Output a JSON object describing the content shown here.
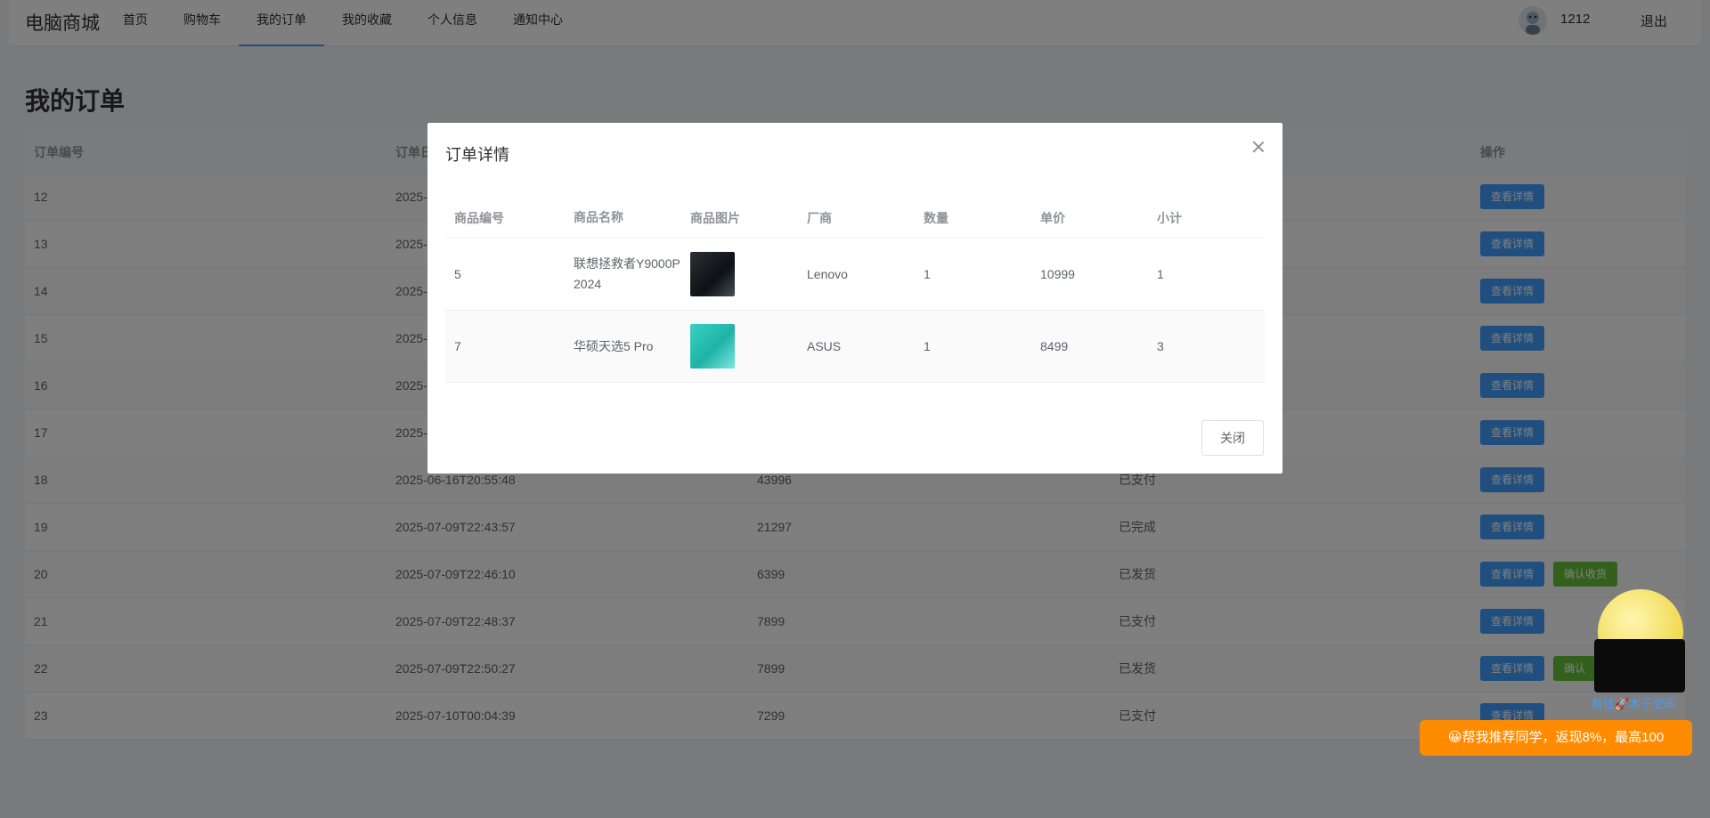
{
  "header": {
    "brand": "电脑商城",
    "nav": [
      "首页",
      "购物车",
      "我的订单",
      "我的收藏",
      "个人信息",
      "通知中心"
    ],
    "active_nav": "我的订单",
    "username": "1212",
    "logout": "退出"
  },
  "page": {
    "title": "我的订单"
  },
  "orders": {
    "columns": [
      "订单编号",
      "订单日期",
      "",
      "",
      "操作"
    ],
    "rows": [
      {
        "id": "12",
        "date": "2025-",
        "amount": "",
        "status": "",
        "action": "查看详情",
        "extra": ""
      },
      {
        "id": "13",
        "date": "2025-",
        "amount": "",
        "status": "",
        "action": "查看详情",
        "extra": ""
      },
      {
        "id": "14",
        "date": "2025-",
        "amount": "",
        "status": "",
        "action": "查看详情",
        "extra": ""
      },
      {
        "id": "15",
        "date": "2025-",
        "amount": "",
        "status": "",
        "action": "查看详情",
        "extra": ""
      },
      {
        "id": "16",
        "date": "2025-",
        "amount": "",
        "status": "",
        "action": "查看详情",
        "extra": ""
      },
      {
        "id": "17",
        "date": "2025-",
        "amount": "",
        "status": "",
        "action": "查看详情",
        "extra": ""
      },
      {
        "id": "18",
        "date": "2025-06-16T20:55:48",
        "amount": "43996",
        "status": "已支付",
        "action": "查看详情",
        "extra": ""
      },
      {
        "id": "19",
        "date": "2025-07-09T22:43:57",
        "amount": "21297",
        "status": "已完成",
        "action": "查看详情",
        "extra": ""
      },
      {
        "id": "20",
        "date": "2025-07-09T22:46:10",
        "amount": "6399",
        "status": "已发货",
        "action": "查看详情",
        "extra": "确认收货"
      },
      {
        "id": "21",
        "date": "2025-07-09T22:48:37",
        "amount": "7899",
        "status": "已支付",
        "action": "查看详情",
        "extra": ""
      },
      {
        "id": "22",
        "date": "2025-07-09T22:50:27",
        "amount": "7899",
        "status": "已发货",
        "action": "查看详情",
        "extra": "确认"
      },
      {
        "id": "23",
        "date": "2025-07-10T00:04:39",
        "amount": "7299",
        "status": "已支付",
        "action": "查看详情",
        "extra": ""
      }
    ]
  },
  "dialog": {
    "title": "订单详情",
    "columns": [
      "商品编号",
      "商品名称",
      "商品图片",
      "厂商",
      "数量",
      "单价",
      "小计"
    ],
    "rows": [
      {
        "id": "5",
        "name": "联想拯救者Y9000P 2024",
        "image": "laptop-dark",
        "maker": "Lenovo",
        "qty": "1",
        "price": "10999",
        "subtotal": "1"
      },
      {
        "id": "7",
        "name": "华硕天选5 Pro",
        "image": "laptop-teal",
        "maker": "ASUS",
        "qty": "1",
        "price": "8499",
        "subtotal": "3"
      }
    ],
    "close_label": "关闭"
  },
  "widgets": {
    "mascot_link": "前往🚀木子空间",
    "promo": "😀帮我推荐同学，返现8%，最高100"
  },
  "colors": {
    "primary": "#409eff",
    "success": "#67c23a",
    "promo": "#ff8b00"
  }
}
